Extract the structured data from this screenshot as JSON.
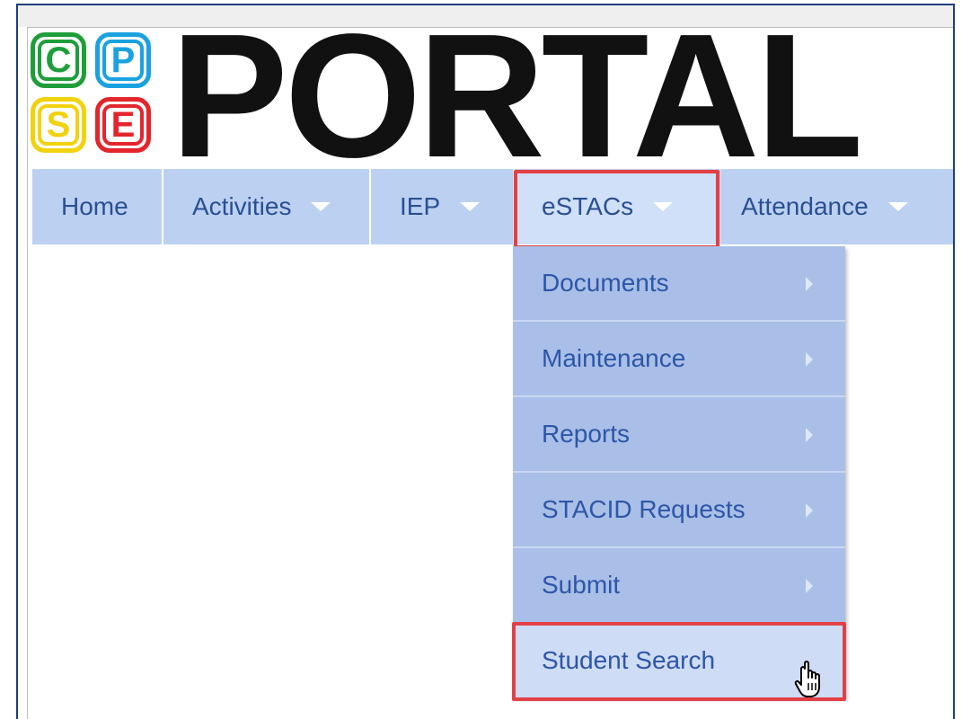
{
  "logo": {
    "tiles": [
      {
        "letter": "C",
        "color": "#1e9e3a"
      },
      {
        "letter": "P",
        "color": "#1aa2e0"
      },
      {
        "letter": "S",
        "color": "#f2d20c"
      },
      {
        "letter": "E",
        "color": "#e3262c"
      }
    ],
    "word": "PORTAL"
  },
  "nav": {
    "items": [
      {
        "label": "Home",
        "has_caret": false
      },
      {
        "label": "Activities",
        "has_caret": true
      },
      {
        "label": "IEP",
        "has_caret": true
      },
      {
        "label": "eSTACs",
        "has_caret": true,
        "active": true
      },
      {
        "label": "Attendance",
        "has_caret": true
      }
    ]
  },
  "dropdown": {
    "items": [
      {
        "label": "Documents",
        "has_submenu": true
      },
      {
        "label": "Maintenance",
        "has_submenu": true
      },
      {
        "label": "Reports",
        "has_submenu": true
      },
      {
        "label": "STACID Requests",
        "has_submenu": true
      },
      {
        "label": "Submit",
        "has_submenu": true
      },
      {
        "label": "Student Search",
        "has_submenu": false,
        "hovered": true
      }
    ]
  },
  "colors": {
    "nav_bg": "#bcd1f2",
    "nav_text": "#2a4f93",
    "dropdown_bg": "#a9bfe7",
    "dropdown_hover_bg": "#cfdcf6",
    "highlight": "#e24046"
  },
  "icons": {
    "cursor": "hand-pointer-icon",
    "submenu": "triangle-right-icon",
    "dropdown": "caret-down-icon"
  }
}
